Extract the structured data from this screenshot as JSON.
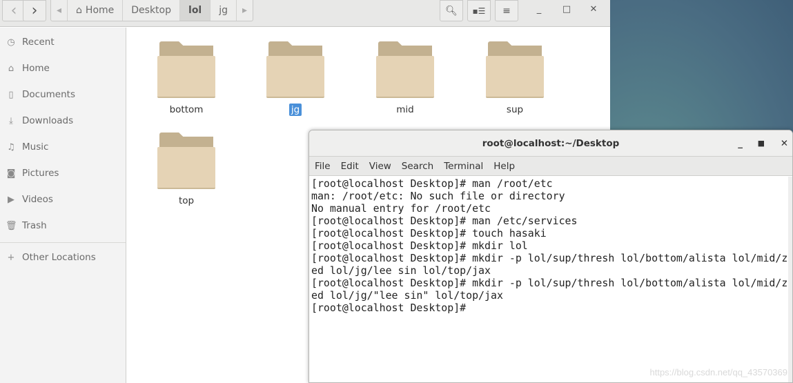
{
  "toolbar": {
    "back": "‹",
    "forward": "›",
    "path": [
      {
        "label": "Home",
        "icon": "home-icon"
      },
      {
        "label": "Desktop"
      },
      {
        "label": "lol",
        "active": true
      },
      {
        "label": "jg"
      }
    ],
    "search_icon": "search-icon",
    "view_icon": "list-view-icon",
    "menu_icon": "hamburger-menu-icon"
  },
  "sidebar": {
    "items": [
      {
        "label": "Recent",
        "icon": "clock-icon"
      },
      {
        "label": "Home",
        "icon": "home-icon"
      },
      {
        "label": "Documents",
        "icon": "document-icon"
      },
      {
        "label": "Downloads",
        "icon": "download-icon"
      },
      {
        "label": "Music",
        "icon": "music-icon"
      },
      {
        "label": "Pictures",
        "icon": "camera-icon"
      },
      {
        "label": "Videos",
        "icon": "video-icon"
      },
      {
        "label": "Trash",
        "icon": "trash-icon"
      }
    ],
    "other": "Other Locations"
  },
  "folders": [
    {
      "name": "bottom"
    },
    {
      "name": "jg",
      "selected": true
    },
    {
      "name": "mid"
    },
    {
      "name": "sup"
    },
    {
      "name": "top"
    }
  ],
  "terminal": {
    "title": "root@localhost:~/Desktop",
    "menu": [
      "File",
      "Edit",
      "View",
      "Search",
      "Terminal",
      "Help"
    ],
    "lines": [
      "[root@localhost Desktop]# man /root/etc",
      "man: /root/etc: No such file or directory",
      "No manual entry for /root/etc",
      "[root@localhost Desktop]# man /etc/services",
      "[root@localhost Desktop]# touch hasaki",
      "[root@localhost Desktop]# mkdir lol",
      "[root@localhost Desktop]# mkdir -p lol/sup/thresh lol/bottom/alista lol/mid/z",
      "ed lol/jg/lee sin lol/top/jax",
      "[root@localhost Desktop]# mkdir -p lol/sup/thresh lol/bottom/alista lol/mid/z",
      "ed lol/jg/\"lee sin\" lol/top/jax",
      "[root@localhost Desktop]# "
    ]
  },
  "watermark": "https://blog.csdn.net/qq_43570369",
  "colors": {
    "selection": "#4a90d9",
    "folder": "#e5d3b5"
  }
}
